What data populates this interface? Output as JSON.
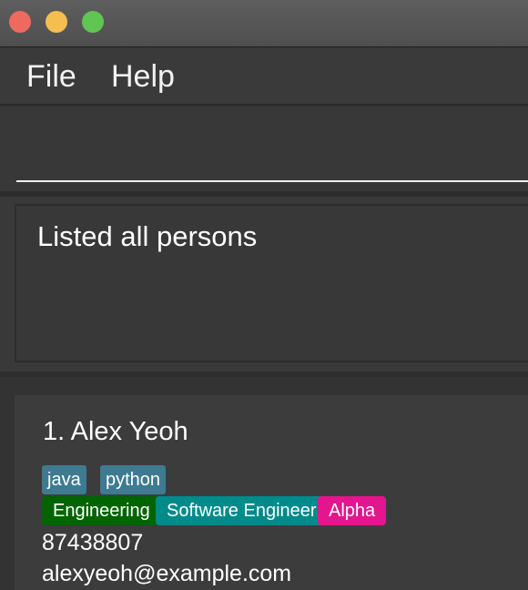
{
  "menu": {
    "file_label": "File",
    "help_label": "Help"
  },
  "command_box": {
    "value": "",
    "placeholder": ""
  },
  "result_display": {
    "message": "Listed all persons"
  },
  "person_list": {
    "persons": [
      {
        "index_name": "1. Alex Yeoh",
        "tags": [
          "java",
          "python"
        ],
        "groups": [
          "Engineering",
          "Software Engineer",
          "Alpha"
        ],
        "phone": "87438807",
        "email": "alexyeoh@example.com"
      }
    ]
  },
  "colors": {
    "tag_skill": "#3e7b91",
    "tag_engineering": "#006400",
    "tag_role": "#008b8b",
    "tag_alpha": "#e3168d",
    "close_button": "#ee6a5f",
    "minimize_button": "#f4bf4f",
    "maximize_button": "#61c554"
  }
}
